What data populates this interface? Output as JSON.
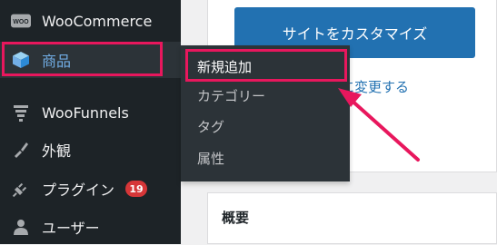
{
  "sidebar": {
    "items": [
      {
        "label": "WooCommerce",
        "icon": "woo-icon"
      },
      {
        "label": "商品",
        "icon": "cube-icon"
      },
      {
        "label": "WooFunnels",
        "icon": "funnel-icon"
      },
      {
        "label": "外観",
        "icon": "paintbrush-icon"
      },
      {
        "label": "プラグイン",
        "icon": "plug-icon",
        "badge": "19"
      },
      {
        "label": "ユーザー",
        "icon": "user-icon"
      }
    ],
    "woo_logo_text": "WOO"
  },
  "flyout": {
    "items": [
      "新規追加",
      "カテゴリー",
      "タグ",
      "属性"
    ]
  },
  "main": {
    "customize_button": "サイトをカスタマイズ",
    "change_link": "イに変更する",
    "overview_title": "概要"
  },
  "colors": {
    "highlight": "#e8175d",
    "sidebar_bg": "#1d2327",
    "accent": "#2271b1",
    "badge": "#d63638"
  }
}
